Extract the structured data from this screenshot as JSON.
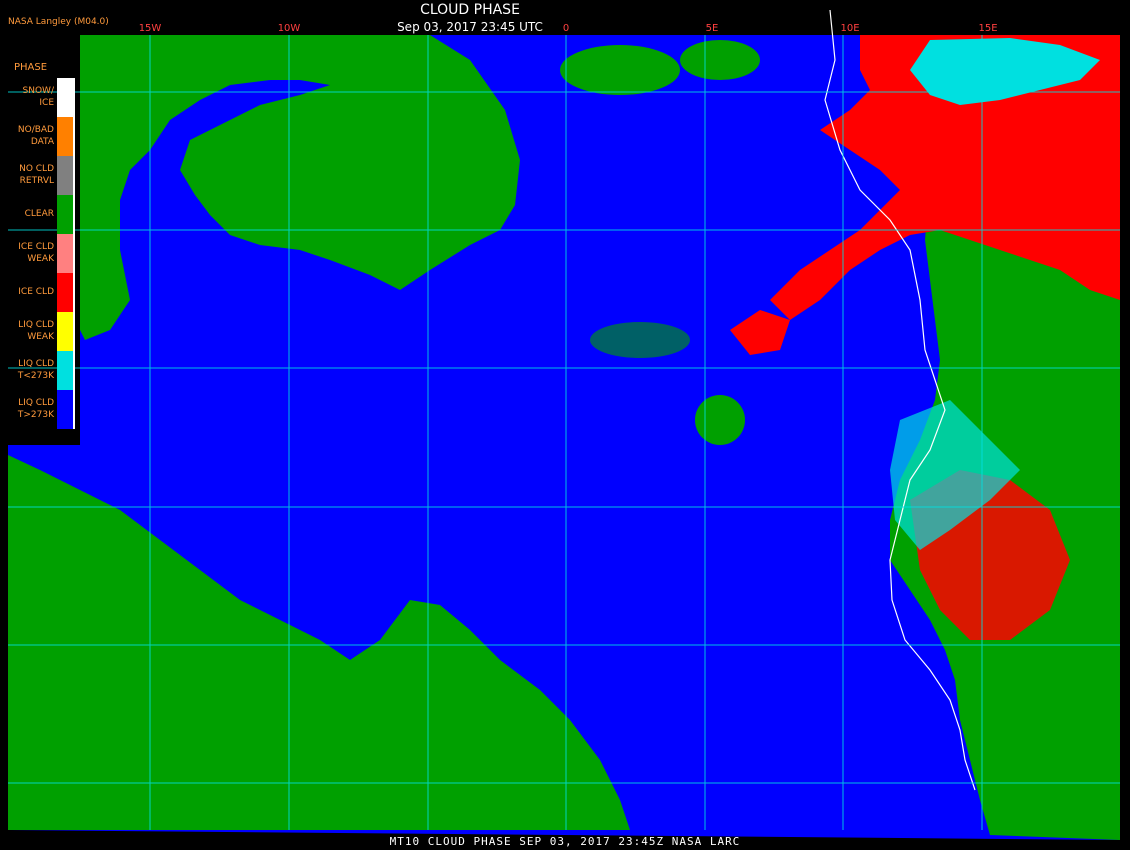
{
  "header": {
    "title": "CLOUD PHASE",
    "datetime": "Sep 03, 2017 23:45 UTC",
    "source": "NASA Langley (M04.0)"
  },
  "footer": "MT10  CLOUD PHASE  SEP 03, 2017 23:45Z  NASA LARC",
  "longitude_labels": [
    "15W",
    "10W",
    "0",
    "5E",
    "10E",
    "15E"
  ],
  "legend": {
    "title": "PHASE",
    "items": [
      {
        "label": "SNOW/\nICE",
        "color": "#ffffff"
      },
      {
        "label": "NO/BAD\nDATA",
        "color": "#ff8000"
      },
      {
        "label": "NO CLD\nRETRVL",
        "color": "#808080"
      },
      {
        "label": "CLEAR",
        "color": "#00a000"
      },
      {
        "label": "ICE CLD\nWEAK",
        "color": "#ff8080"
      },
      {
        "label": "ICE CLD",
        "color": "#ff0000"
      },
      {
        "label": "LIQ CLD\nWEAK",
        "color": "#ffff00"
      },
      {
        "label": "LIQ CLD\nT<273K",
        "color": "#00e0e0"
      },
      {
        "label": "LIQ CLD\nT>273K",
        "color": "#0000ff"
      }
    ]
  },
  "colors": {
    "ocean_liquid_cloud": "#0000ff",
    "clear": "#00a000",
    "ice_cloud": "#ff0000",
    "liquid_cold": "#00e0e0",
    "gridline": "#00e0e0",
    "coastline": "#ffffff",
    "header_text": "#ffffff",
    "accent_text": "#ff9a3c",
    "lon_label": "#ff4040"
  }
}
